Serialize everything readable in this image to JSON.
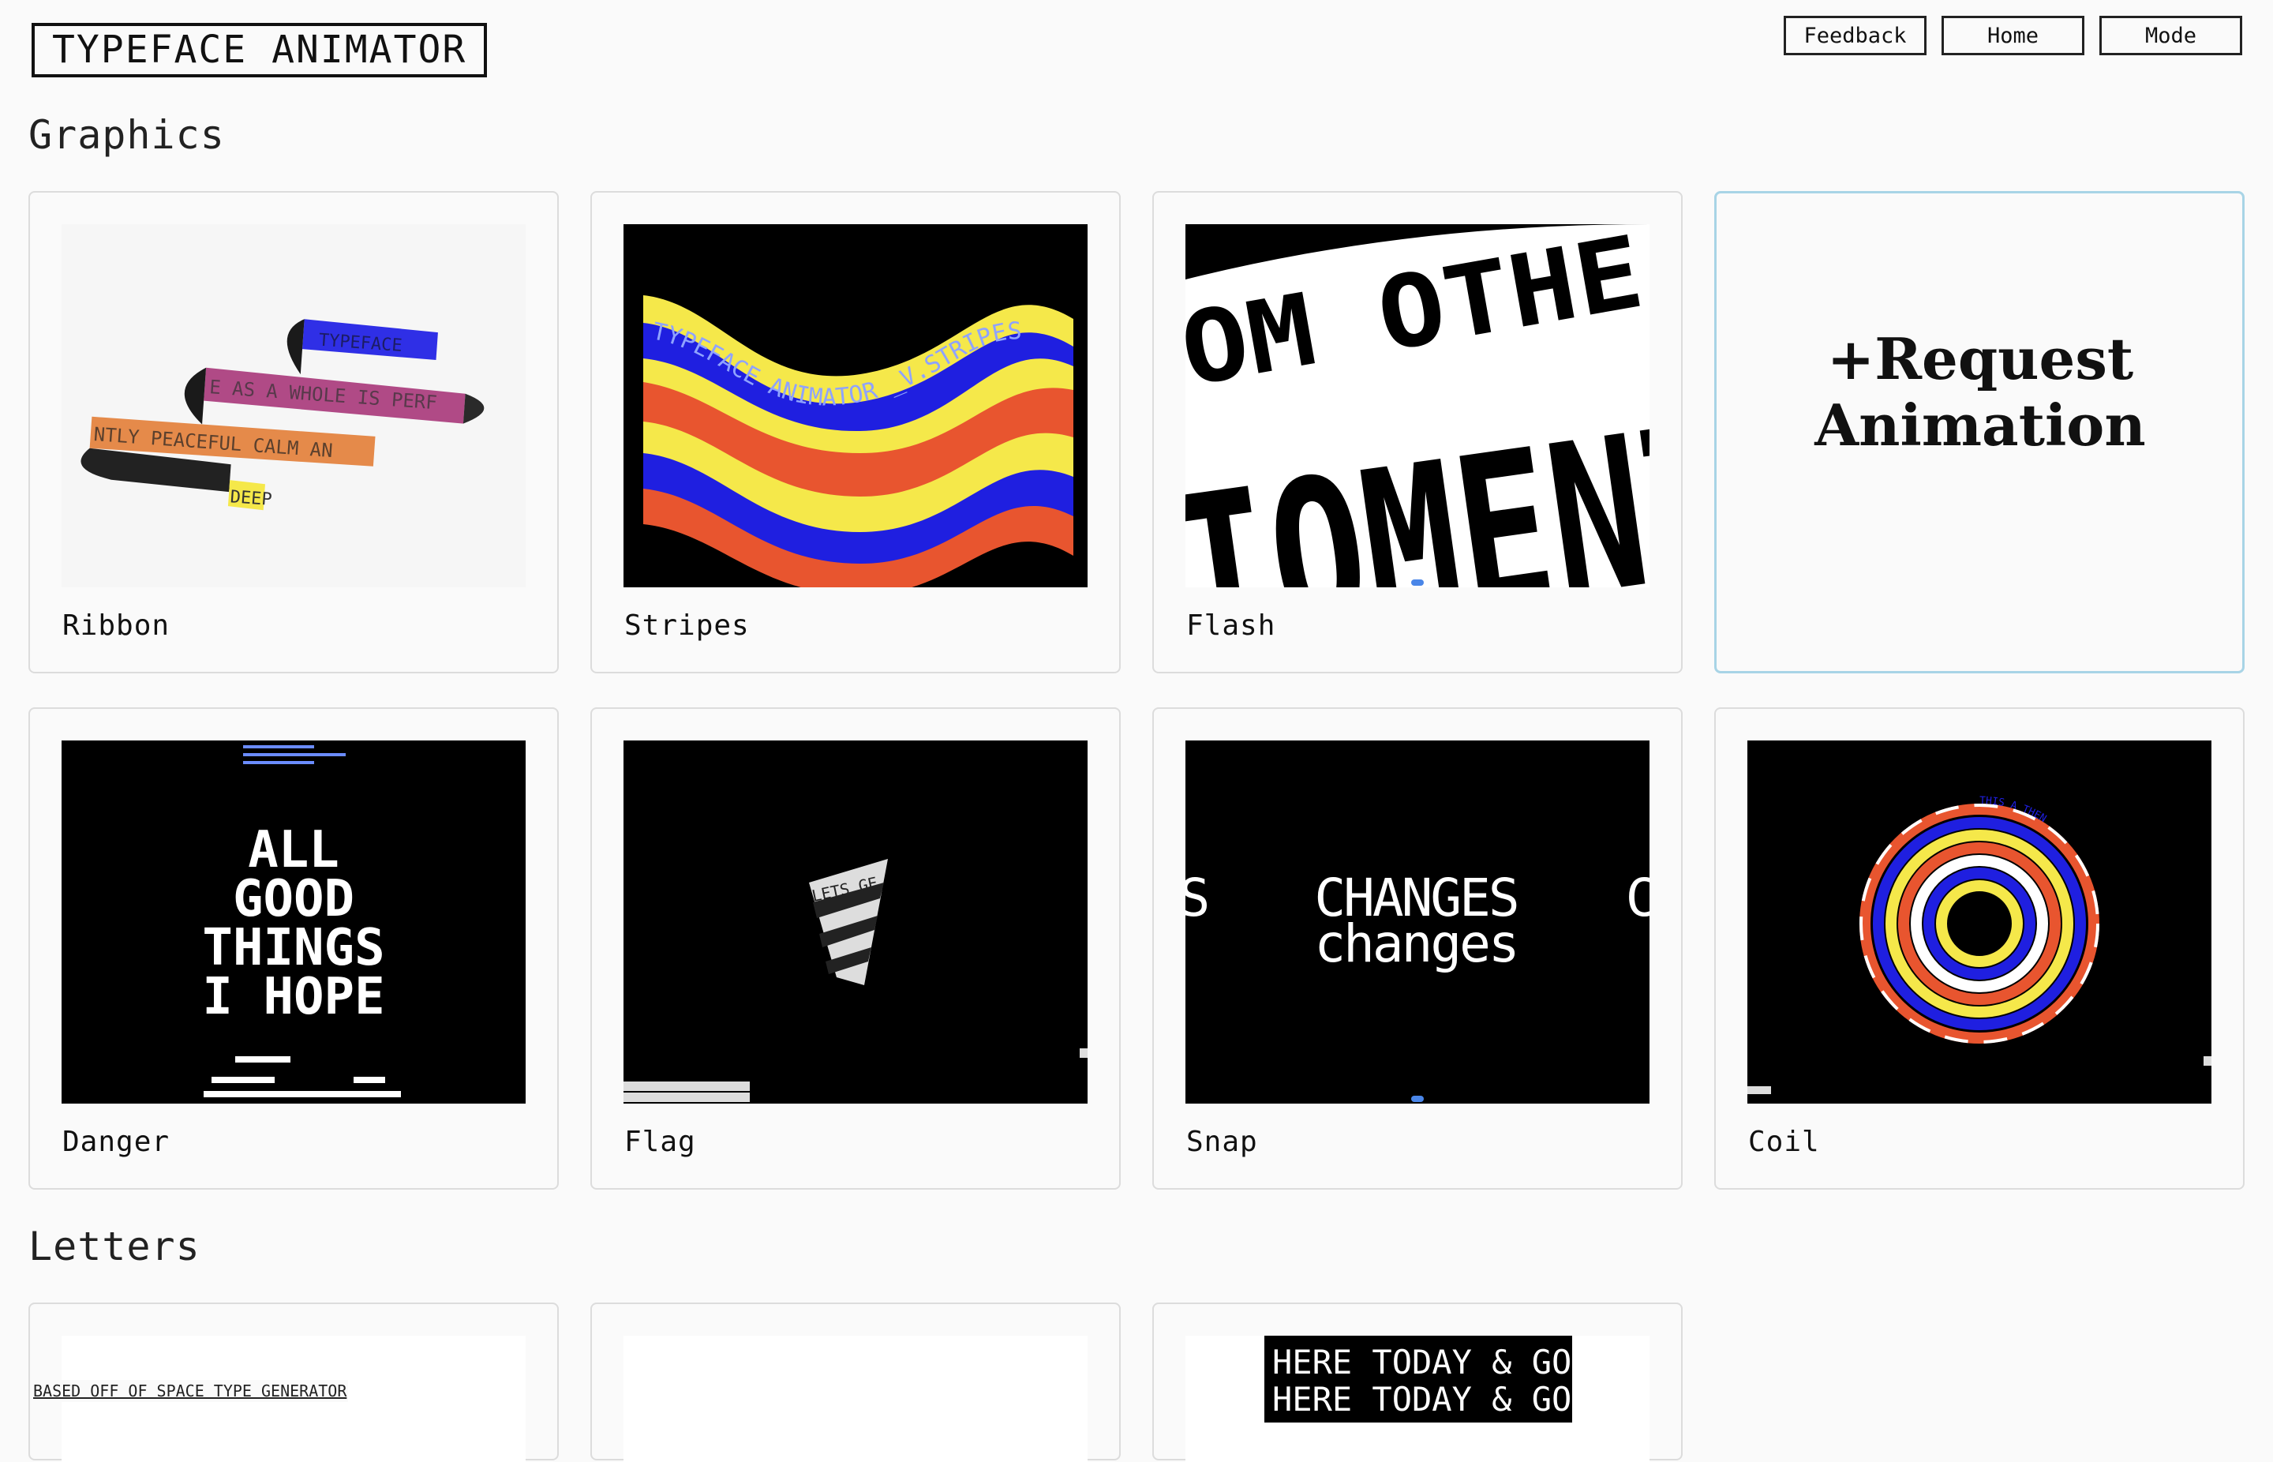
{
  "header": {
    "logo": "TYPEFACE ANIMATOR",
    "nav": {
      "feedback": "Feedback",
      "home": "Home",
      "mode": "Mode"
    }
  },
  "sections": {
    "graphics": "Graphics",
    "letters": "Letters"
  },
  "cards": {
    "ribbon": {
      "label": "Ribbon",
      "thumb_text": {
        "t1": "TYPEFACE",
        "t2": "E AS A WHOLE IS PERF",
        "t3": "NTLY PEACEFUL  CALM AN",
        "t4": "DEEP"
      }
    },
    "stripes": {
      "label": "Stripes",
      "thumb_text": "TYPEFACE ANIMATOR _V.STRIPES"
    },
    "flash": {
      "label": "Flash",
      "thumb_text": {
        "top": "OM OTHE",
        "big": "IOMENTS"
      }
    },
    "request": {
      "line1": "+Request",
      "line2": "Animation"
    },
    "danger": {
      "label": "Danger",
      "thumb_text": [
        "ALL",
        "GOOD",
        "THINGS",
        "I HOPE"
      ]
    },
    "flag": {
      "label": "Flag",
      "thumb_text": "LETS GE"
    },
    "snap": {
      "label": "Snap",
      "thumb_text": {
        "upper": "CHANGES",
        "lower": "changes",
        "left": "S",
        "right": "C"
      }
    },
    "coil": {
      "label": "Coil",
      "thumb_text": "THIS A THEN"
    },
    "letters_3": {
      "thumb_text": "HERE TODAY & GONE TOMORROW"
    }
  },
  "footer": {
    "link": "BASED OFF OF SPACE TYPE GENERATOR"
  },
  "colors": {
    "background": "#fafafa",
    "card_border": "#dcdcdc",
    "highlight_border": "#a8d4e6",
    "stripe_blue": "#1f1fe0",
    "stripe_yellow": "#f5e84a",
    "stripe_red": "#e8552f"
  }
}
